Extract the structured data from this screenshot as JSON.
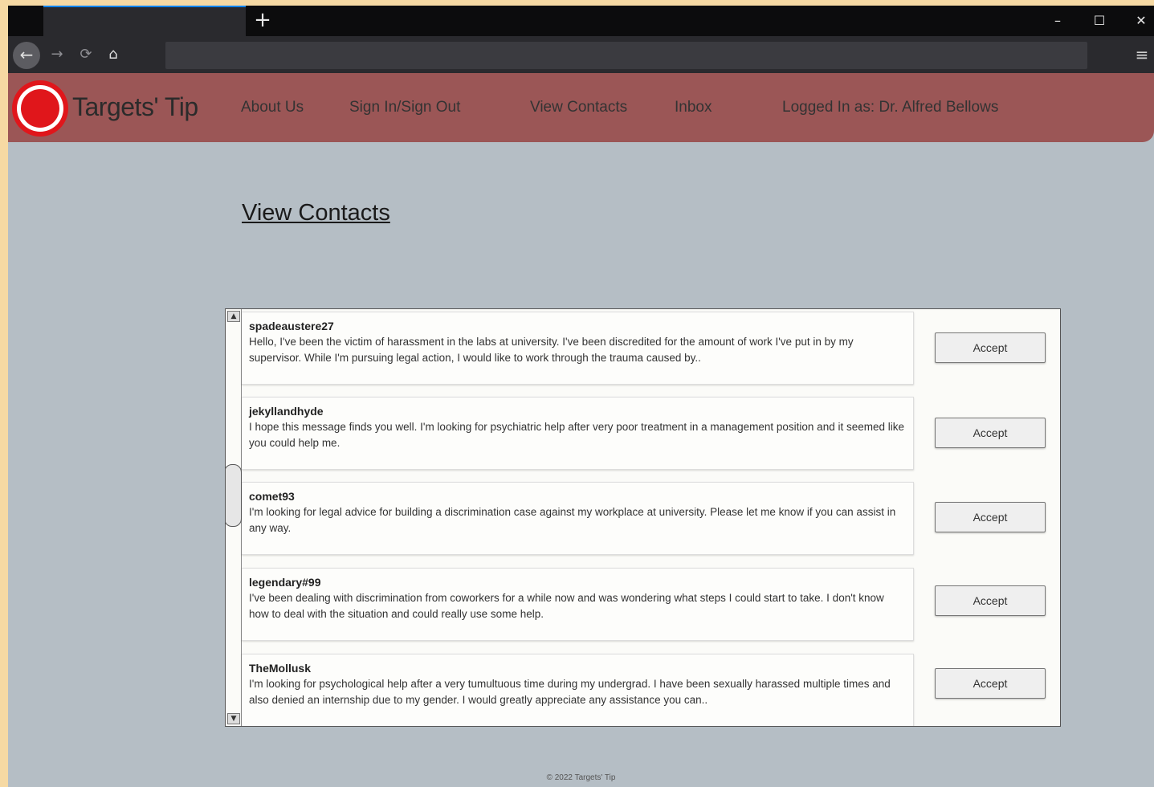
{
  "browser": {
    "new_tab_icon": "+",
    "minimize_icon": "–",
    "maximize_icon": "☐",
    "close_icon": "✕",
    "back_icon": "←",
    "forward_icon": "→",
    "reload_icon": "⟳",
    "home_icon": "⌂",
    "menu_icon": "≡"
  },
  "header": {
    "brand": "Targets' Tip",
    "logo_colors": {
      "ring": "#e0161b",
      "inner": "#ffffff",
      "core": "#e0161b"
    },
    "nav": {
      "about": "About Us",
      "signin": "Sign In/Sign Out",
      "contacts": "View Contacts",
      "inbox": "Inbox",
      "logged_in": "Logged In as: Dr. Alfred Bellows"
    }
  },
  "page": {
    "title": "View Contacts"
  },
  "scrollbar": {
    "up_icon": "▲",
    "down_icon": "▼"
  },
  "contacts": [
    {
      "username": "spadeaustere27",
      "message": "Hello, I've been the victim of harassment in the labs at university. I've been discredited for the amount of work I've put in by my supervisor. While I'm pursuing legal action, I would like to work through the trauma caused by..",
      "action": "Accept"
    },
    {
      "username": "jekyllandhyde",
      "message": "I hope this message finds you well. I'm looking for psychiatric help after very poor treatment in a management position and it seemed like you could help me.",
      "action": "Accept"
    },
    {
      "username": "comet93",
      "message": "I'm looking for legal advice for building a discrimination case against my workplace at university. Please let me know if you can assist in any way.",
      "action": "Accept"
    },
    {
      "username": "legendary#99",
      "message": "I've been dealing with discrimination from coworkers for a while now and was wondering what steps I could start to take. I don't know how to deal with the situation and could really use some help.",
      "action": "Accept"
    },
    {
      "username": "TheMollusk",
      "message": "I'm looking for psychological help after a very tumultuous time during my undergrad. I have been sexually harassed multiple times and also denied an internship due to my gender. I would greatly appreciate any assistance you can..",
      "action": "Accept"
    }
  ],
  "footer": {
    "text": "© 2022 Targets' Tip"
  }
}
